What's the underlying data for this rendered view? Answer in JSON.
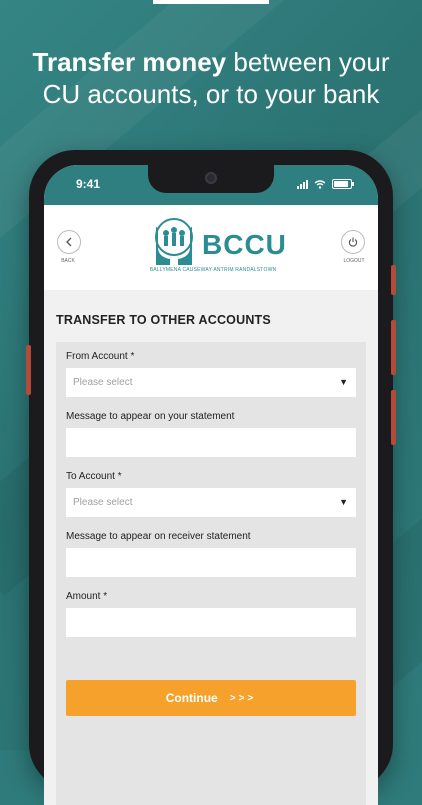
{
  "promo": {
    "headline_bold": "Transfer money",
    "headline_rest": " between your",
    "headline_line2": "CU accounts, or to your bank"
  },
  "status_bar": {
    "time": "9:41"
  },
  "header": {
    "back_label": "BACK",
    "logout_label": "LOGOUT",
    "logo_text": "BCCU",
    "logo_subtitle": "BALLYMENA CAUSEWAY ANTRIM RANDALSTOWN"
  },
  "page": {
    "title": "TRANSFER TO OTHER ACCOUNTS"
  },
  "form": {
    "from_account_label": "From Account *",
    "from_account_placeholder": "Please select",
    "own_message_label": "Message to appear on your statement",
    "own_message_value": "",
    "to_account_label": "To Account *",
    "to_account_placeholder": "Please select",
    "receiver_message_label": "Message to appear on receiver statement",
    "receiver_message_value": "",
    "amount_label": "Amount *",
    "amount_value": "",
    "continue_label": "Continue",
    "continue_arrows": ">>>"
  },
  "colors": {
    "teal": "#2f7f80",
    "accent": "#f5a12b",
    "logo": "#2b8c94"
  }
}
